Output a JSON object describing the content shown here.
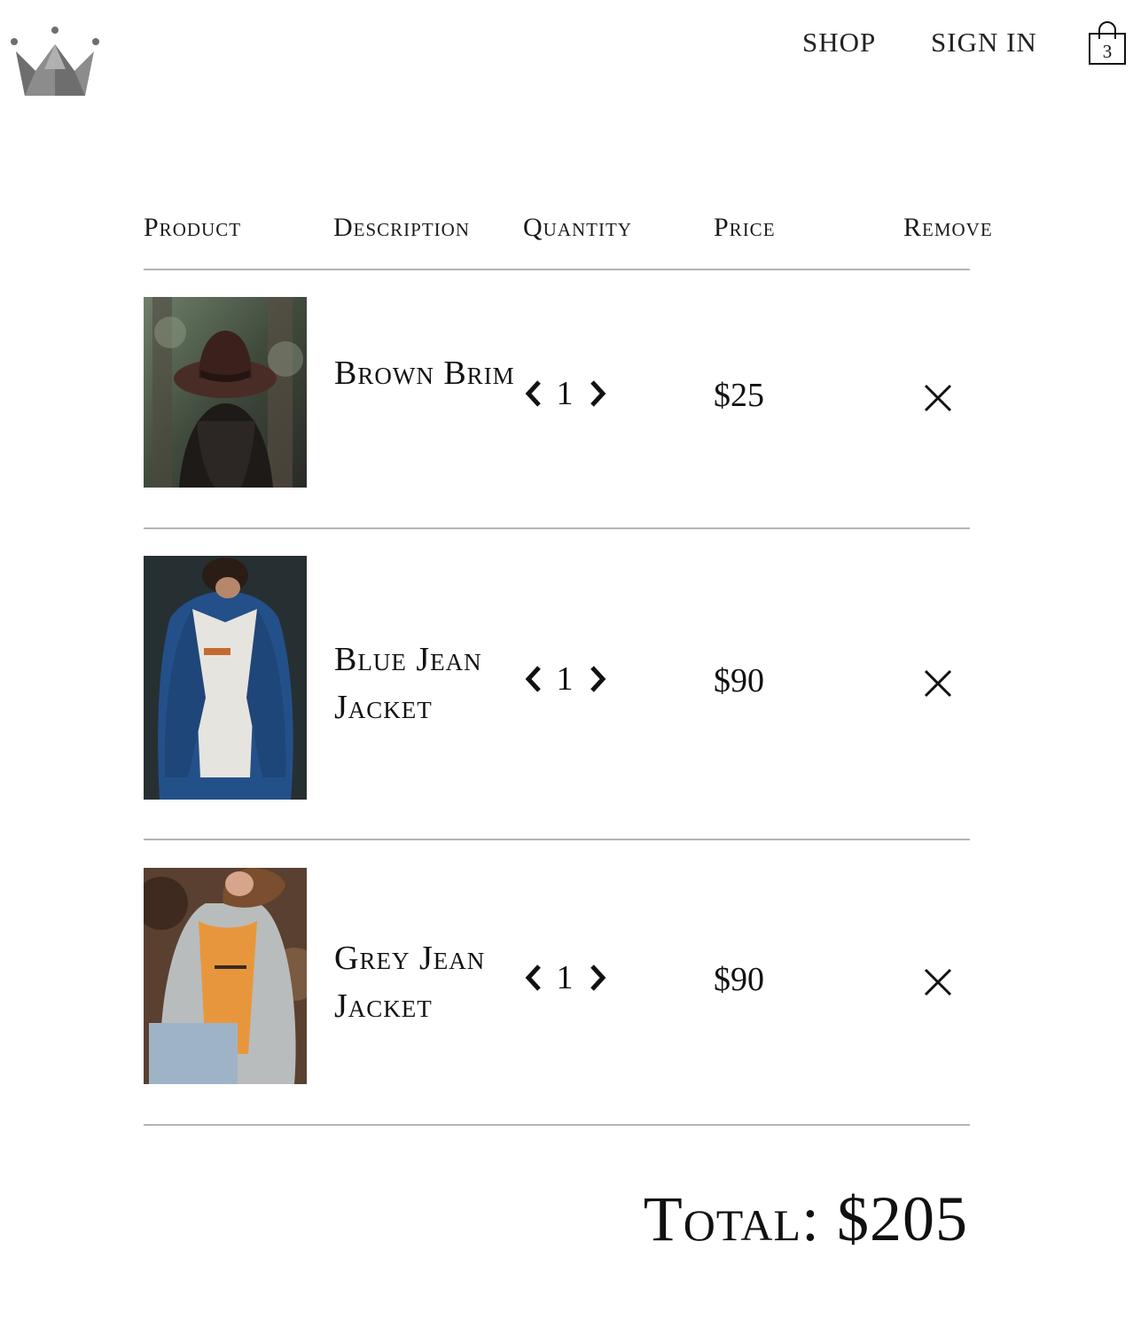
{
  "nav": {
    "shop_label": "SHOP",
    "signin_label": "SIGN IN",
    "cart_count": "3"
  },
  "table": {
    "headers": [
      "Product",
      "Description",
      "Quantity",
      "Price",
      "Remove"
    ],
    "rows": [
      {
        "name": "Brown Brim",
        "quantity": "1",
        "price": "$25"
      },
      {
        "name": "Blue Jean Jacket",
        "quantity": "1",
        "price": "$90"
      },
      {
        "name": "Grey Jean Jacket",
        "quantity": "1",
        "price": "$90"
      }
    ]
  },
  "total_label": "Total: $205",
  "icons": {
    "logo": "crown-icon",
    "cart": "shopping-bag-icon",
    "decrease": "chevron-left-icon",
    "increase": "chevron-right-icon",
    "remove": "close-icon"
  },
  "colors": {
    "logo_gray": "#7a7a7a",
    "rule": "#b4b4b4",
    "text": "#111111"
  }
}
